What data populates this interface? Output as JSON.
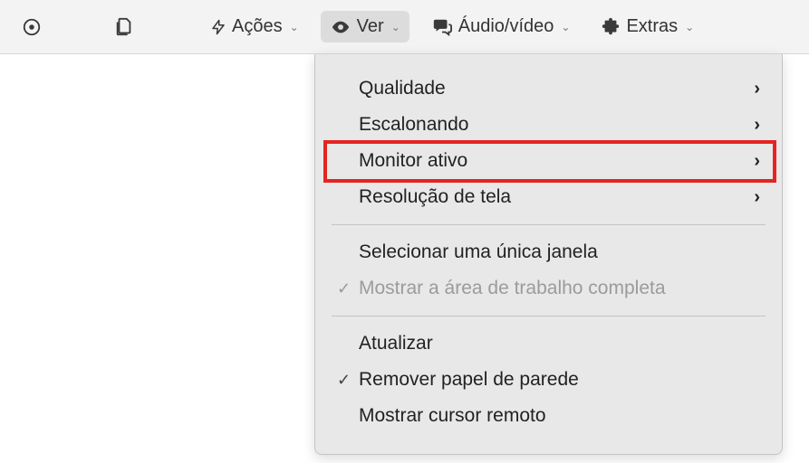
{
  "toolbar": {
    "actions_label": "Ações",
    "view_label": "Ver",
    "av_label": "Áudio/vídeo",
    "extras_label": "Extras"
  },
  "menu": {
    "quality": "Qualidade",
    "scaling": "Escalonando",
    "active_monitor": "Monitor ativo",
    "resolution": "Resolução de tela",
    "select_window": "Selecionar uma única janela",
    "show_full_desktop": "Mostrar a área de trabalho completa",
    "refresh": "Atualizar",
    "remove_wallpaper": "Remover papel de parede",
    "show_remote_cursor": "Mostrar cursor remoto"
  }
}
